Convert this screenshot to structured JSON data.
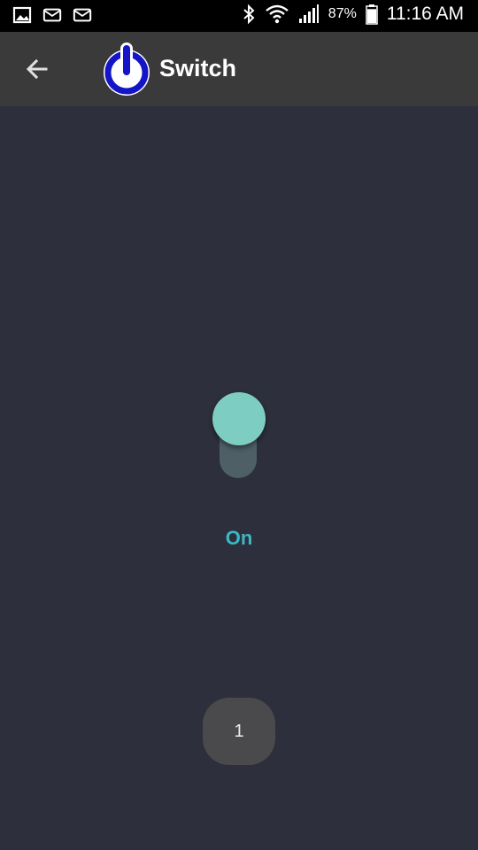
{
  "status_bar": {
    "left_icons": [
      "gallery-icon",
      "mail-icon",
      "mail-icon"
    ],
    "bluetooth_icon": "bluetooth-icon",
    "wifi_icon": "wifi-icon",
    "signal_icon": "signal-icon",
    "battery_percent": "87%",
    "battery_level": 0.87,
    "time": "11:16 AM"
  },
  "app_bar": {
    "back_icon": "back-arrow-icon",
    "logo_icon": "power-icon",
    "title": "Switch",
    "logo_color": "#1515c8"
  },
  "switch": {
    "state": "on",
    "label": "On",
    "thumb_color": "#7ecdc2",
    "track_color": "#4f5f66",
    "label_color": "#3ab8c4"
  },
  "counter": {
    "value": "1"
  }
}
